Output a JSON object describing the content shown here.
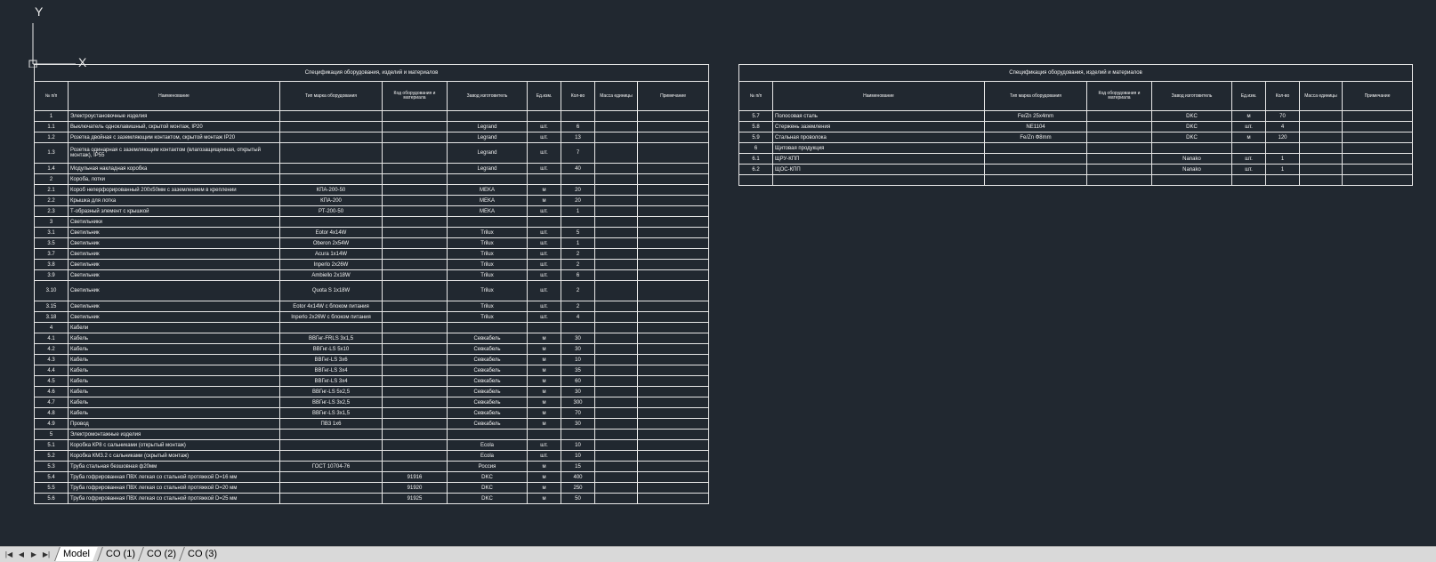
{
  "table1": {
    "title": "Спецификация оборудования, изделий и материалов",
    "headers": [
      "№ п/п",
      "Наименование",
      "Тип марка оборудования",
      "Код оборудования и материала",
      "Завод изготовитель",
      "Ед.изм.",
      "Кол-во",
      "Масса единицы",
      "Примечание"
    ],
    "rows": [
      {
        "no": "1",
        "name": "Электроустановочные изделия",
        "type": "",
        "code": "",
        "maker": "",
        "unit": "",
        "qty": ""
      },
      {
        "no": "1.1",
        "name": "Выключатель одноклавишный, скрытой монтаж, IP20",
        "type": "",
        "code": "",
        "maker": "Legrand",
        "unit": "шт.",
        "qty": "6"
      },
      {
        "no": "1.2",
        "name": "Розетка двойная с заземляющим контактом, скрытой монтаж IP20",
        "type": "",
        "code": "",
        "maker": "Legrand",
        "unit": "шт.",
        "qty": "13"
      },
      {
        "no": "1.3",
        "name": "Розетка одинарная с заземляющим контактом (влагозащищенная, открытый монтаж), IP55",
        "type": "",
        "code": "",
        "maker": "Legrand",
        "unit": "шт.",
        "qty": "7",
        "tall": true
      },
      {
        "no": "1.4",
        "name": "Модульная накладная коробка",
        "type": "",
        "code": "",
        "maker": "Legrand",
        "unit": "шт.",
        "qty": "40"
      },
      {
        "no": "2",
        "name": "Короба, лотки",
        "type": "",
        "code": "",
        "maker": "",
        "unit": "",
        "qty": ""
      },
      {
        "no": "2.1",
        "name": "Короб неперфорированный 200х50мм с заземлением в креплении",
        "type": "КПА-200-50",
        "code": "",
        "maker": "MEKA",
        "unit": "м",
        "qty": "20"
      },
      {
        "no": "2.2",
        "name": "Крышка для лотка",
        "type": "КПА-200",
        "code": "",
        "maker": "MEKA",
        "unit": "м",
        "qty": "20"
      },
      {
        "no": "2.3",
        "name": "Т-образный элемент с крышкой",
        "type": "РТ-200-50",
        "code": "",
        "maker": "MEKA",
        "unit": "шт.",
        "qty": "1"
      },
      {
        "no": "3",
        "name": "Светильники",
        "type": "",
        "code": "",
        "maker": "",
        "unit": "",
        "qty": ""
      },
      {
        "no": "3.1",
        "name": "Светильник",
        "type": "Eotor 4х14W",
        "code": "",
        "maker": "Trilux",
        "unit": "шт.",
        "qty": "5"
      },
      {
        "no": "3.5",
        "name": "Светильник",
        "type": "Oberon 2х54W",
        "code": "",
        "maker": "Trilux",
        "unit": "шт.",
        "qty": "1"
      },
      {
        "no": "3.7",
        "name": "Светильник",
        "type": "Acura 1х14W",
        "code": "",
        "maker": "Trilux",
        "unit": "шт.",
        "qty": "2"
      },
      {
        "no": "3.8",
        "name": "Светильник",
        "type": "Inperlo 2х26W",
        "code": "",
        "maker": "Trilux",
        "unit": "шт.",
        "qty": "2"
      },
      {
        "no": "3.9",
        "name": "Светильник",
        "type": "Ambiello 2х18W",
        "code": "",
        "maker": "Trilux",
        "unit": "шт.",
        "qty": "6"
      },
      {
        "no": "3.10",
        "name": "Светильник",
        "type": "Quota S 1х18W",
        "code": "",
        "maker": "Trilux",
        "unit": "шт.",
        "qty": "2",
        "tall": true
      },
      {
        "no": "3.15",
        "name": "Светильник",
        "type": "Eotor 4х14W с блоком питания",
        "code": "",
        "maker": "Trilux",
        "unit": "шт.",
        "qty": "2"
      },
      {
        "no": "3.18",
        "name": "Светильник",
        "type": "Inperlo 2х26W с блоком питания",
        "code": "",
        "maker": "Trilux",
        "unit": "шт.",
        "qty": "4"
      },
      {
        "no": "4",
        "name": "Кабели",
        "type": "",
        "code": "",
        "maker": "",
        "unit": "",
        "qty": ""
      },
      {
        "no": "4.1",
        "name": "Кабель",
        "type": "ВВГнг-FRLS 3х1,5",
        "code": "",
        "maker": "Севкабель",
        "unit": "м",
        "qty": "30"
      },
      {
        "no": "4.2",
        "name": "Кабель",
        "type": "ВВГнг-LS 5х10",
        "code": "",
        "maker": "Севкабель",
        "unit": "м",
        "qty": "30"
      },
      {
        "no": "4.3",
        "name": "Кабель",
        "type": "ВВГнг-LS 3х6",
        "code": "",
        "maker": "Севкабель",
        "unit": "м",
        "qty": "10"
      },
      {
        "no": "4.4",
        "name": "Кабель",
        "type": "ВВГнг-LS 3х4",
        "code": "",
        "maker": "Севкабель",
        "unit": "м",
        "qty": "35"
      },
      {
        "no": "4.5",
        "name": "Кабель",
        "type": "ВВГнг-LS 3х4",
        "code": "",
        "maker": "Севкабель",
        "unit": "м",
        "qty": "60"
      },
      {
        "no": "4.6",
        "name": "Кабель",
        "type": "ВВГнг-LS 5х2,5",
        "code": "",
        "maker": "Севкабель",
        "unit": "м",
        "qty": "30"
      },
      {
        "no": "4.7",
        "name": "Кабель",
        "type": "ВВГнг-LS 3х2,5",
        "code": "",
        "maker": "Севкабель",
        "unit": "м",
        "qty": "300"
      },
      {
        "no": "4.8",
        "name": "Кабель",
        "type": "ВВГнг-LS 3х1,5",
        "code": "",
        "maker": "Севкабель",
        "unit": "м",
        "qty": "70"
      },
      {
        "no": "4.9",
        "name": "Провод",
        "type": "ПВ3 1х6",
        "code": "",
        "maker": "Севкабель",
        "unit": "м",
        "qty": "30"
      },
      {
        "no": "5",
        "name": "Электромонтажные изделия",
        "type": "",
        "code": "",
        "maker": "",
        "unit": "",
        "qty": ""
      },
      {
        "no": "5.1",
        "name": "Коробка КР8 с сальниками (открытый монтаж)",
        "type": "",
        "code": "",
        "maker": "Ecola",
        "unit": "шт.",
        "qty": "10"
      },
      {
        "no": "5.2",
        "name": "Коробка КМЗ.2 с сальниками (скрытый монтаж)",
        "type": "",
        "code": "",
        "maker": "Ecola",
        "unit": "шт.",
        "qty": "10"
      },
      {
        "no": "5.3",
        "name": "Труба стальная безшовная ф20мм",
        "type": "ГОСТ 10704-76",
        "code": "",
        "maker": "Россия",
        "unit": "м",
        "qty": "15"
      },
      {
        "no": "5.4",
        "name": "Труба гофрированная ПВХ легкая со стальной протяжкой D=16 мм",
        "type": "",
        "code": "91916",
        "maker": "DKC",
        "unit": "м",
        "qty": "400"
      },
      {
        "no": "5.5",
        "name": "Труба гофрированная ПВХ легкая со стальной протяжкой D=20 мм",
        "type": "",
        "code": "91920",
        "maker": "DKC",
        "unit": "м",
        "qty": "250"
      },
      {
        "no": "5.6",
        "name": "Труба гофрированная ПВХ легкая со стальной протяжкой D=25 мм",
        "type": "",
        "code": "91925",
        "maker": "DKC",
        "unit": "м",
        "qty": "50"
      }
    ]
  },
  "table2": {
    "title": "Спецификация оборудования, изделий и материалов",
    "headers": [
      "№ п/п",
      "Наименование",
      "Тип марка оборудования",
      "Код оборудования и материала",
      "Завод изготовитель",
      "Ед.изм.",
      "Кол-во",
      "Масса единицы",
      "Примечание"
    ],
    "rows": [
      {
        "no": "5.7",
        "name": "Полосовая сталь",
        "type": "Fe/Zn 25х4mm",
        "code": "",
        "maker": "DKC",
        "unit": "м",
        "qty": "70"
      },
      {
        "no": "5.8",
        "name": "Стержень заземления",
        "type": "NE1104",
        "code": "",
        "maker": "DKC",
        "unit": "шт.",
        "qty": "4"
      },
      {
        "no": "5.9",
        "name": "Стальная проволока",
        "type": "Fe/Zn Ф8mm",
        "code": "",
        "maker": "DKC",
        "unit": "м",
        "qty": "120"
      },
      {
        "no": "6",
        "name": "Щитовая продукция",
        "type": "",
        "code": "",
        "maker": "",
        "unit": "",
        "qty": ""
      },
      {
        "no": "6.1",
        "name": "ЩРУ-КПП",
        "type": "",
        "code": "",
        "maker": "Nanako",
        "unit": "шт.",
        "qty": "1"
      },
      {
        "no": "6.2",
        "name": "ЩОС-КПП",
        "type": "",
        "code": "",
        "maker": "Nanako",
        "unit": "шт.",
        "qty": "1"
      },
      {
        "no": "",
        "name": "",
        "type": "",
        "code": "",
        "maker": "",
        "unit": "",
        "qty": ""
      }
    ]
  },
  "ucs": {
    "x_label": "X",
    "y_label": "Y"
  },
  "tabs": [
    "Model",
    "CO (1)",
    "CO (2)",
    "CO (3)"
  ],
  "active_tab": "Model",
  "nav_icons": [
    "first-tab-icon",
    "prev-tab-icon",
    "next-tab-icon",
    "last-tab-icon"
  ],
  "colors": {
    "background": "#212830",
    "lines": "#e8e8e8",
    "tabbar": "#d9d9d9"
  }
}
